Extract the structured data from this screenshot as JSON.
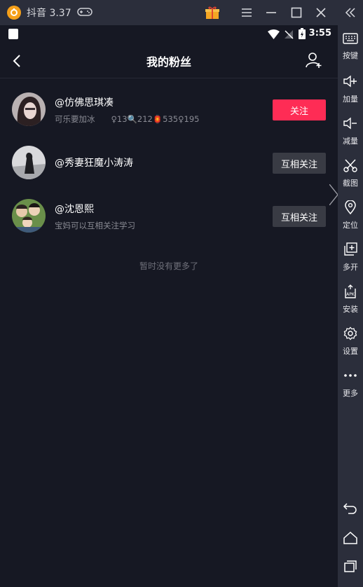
{
  "emulator": {
    "title": "抖音 3.37",
    "status_time": "3:55",
    "sidebar": [
      {
        "label": "按键",
        "icon": "keyboard-icon"
      },
      {
        "label": "加量",
        "icon": "volume-up-icon"
      },
      {
        "label": "减量",
        "icon": "volume-down-icon"
      },
      {
        "label": "截图",
        "icon": "scissors-icon"
      },
      {
        "label": "定位",
        "icon": "location-icon"
      },
      {
        "label": "多开",
        "icon": "multi-open-icon"
      },
      {
        "label": "安装",
        "icon": "apk-install-icon"
      },
      {
        "label": "设置",
        "icon": "gear-icon"
      },
      {
        "label": "更多",
        "icon": "more-icon"
      }
    ]
  },
  "header": {
    "title": "我的粉丝"
  },
  "followers": [
    {
      "name": "@仿佛思琪凑",
      "sub": "可乐要加冰　　♀13🔍212🏮535♀195",
      "button": "关注",
      "style": "follow"
    },
    {
      "name": "@秀妻狂魔小涛涛",
      "sub": "",
      "button": "互相关注",
      "style": "mutual"
    },
    {
      "name": "@沈恩熙",
      "sub": "宝妈可以互相关注学习",
      "button": "互相关注",
      "style": "mutual"
    }
  ],
  "footer": {
    "no_more": "暂时没有更多了"
  },
  "colors": {
    "follow_button": "#fe2c55",
    "mutual_button": "#393b44",
    "background": "#161823"
  }
}
